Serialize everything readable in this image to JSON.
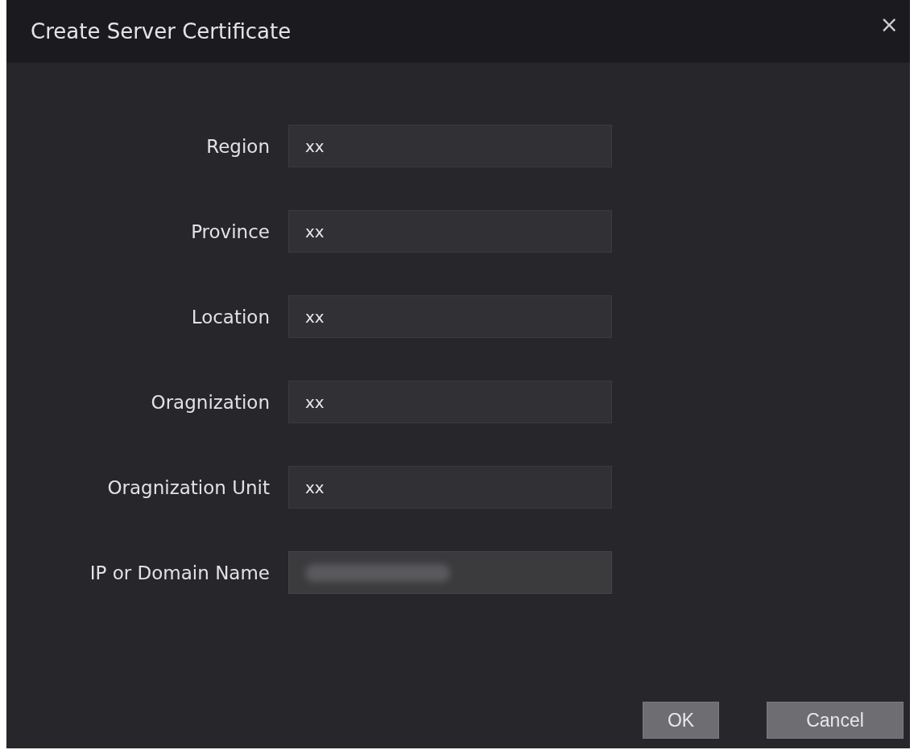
{
  "dialog": {
    "title": "Create Server Certificate",
    "close": "×"
  },
  "fields": [
    {
      "label": "Region",
      "value": "xx",
      "disabled": false,
      "redacted": false
    },
    {
      "label": "Province",
      "value": "xx",
      "disabled": false,
      "redacted": false
    },
    {
      "label": "Location",
      "value": "xx",
      "disabled": false,
      "redacted": false
    },
    {
      "label": "Oragnization",
      "value": "xx",
      "disabled": false,
      "redacted": false
    },
    {
      "label": "Oragnization Unit",
      "value": "xx",
      "disabled": false,
      "redacted": false
    },
    {
      "label": "IP or Domain Name",
      "disabled": true,
      "redacted": true
    }
  ],
  "buttons": [
    {
      "label": "OK",
      "kind": "primary"
    },
    {
      "label": "Cancel",
      "kind": "secondary"
    }
  ]
}
